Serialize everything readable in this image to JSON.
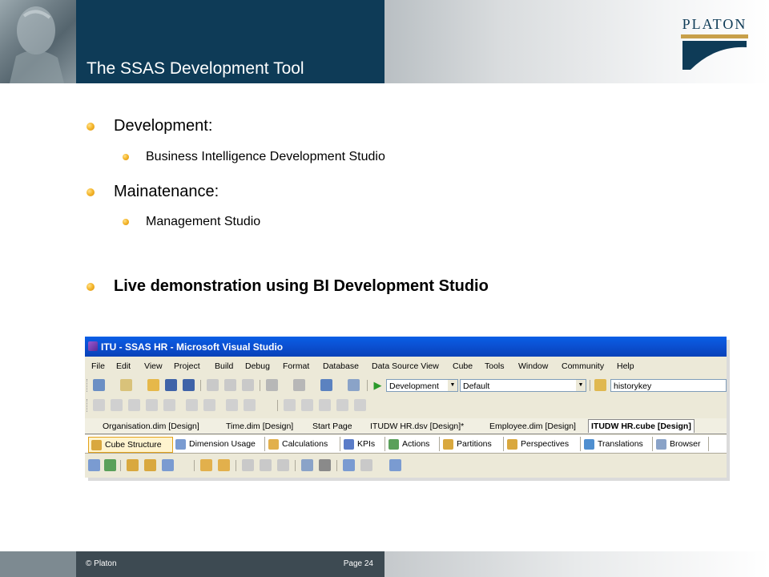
{
  "header": {
    "title": "The SSAS Development Tool",
    "logo_text": "PLATON",
    "colors": {
      "bar": "#0e3b57",
      "accent": "#c8a04a"
    }
  },
  "bullets": [
    {
      "level": 1,
      "text": "Development:"
    },
    {
      "level": 2,
      "text": "Business Intelligence Development Studio"
    },
    {
      "level": 1,
      "text": "Mainatenance:"
    },
    {
      "level": 2,
      "text": "Management Studio"
    },
    {
      "level": 1,
      "text": "Live demonstration using BI Development Studio",
      "bold": true
    }
  ],
  "vs": {
    "window_title": "ITU - SSAS HR - Microsoft Visual Studio",
    "menu": [
      "File",
      "Edit",
      "View",
      "Project",
      "Build",
      "Debug",
      "Format",
      "Database",
      "Data Source View",
      "Cube",
      "Tools",
      "Window",
      "Community",
      "Help"
    ],
    "toolbar": {
      "config_value": "Development",
      "platform_value": "Default",
      "search_value": "historykey"
    },
    "doc_tabs": [
      "Organisation.dim [Design]",
      "Time.dim [Design]",
      "Start Page",
      "ITUDW HR.dsv [Design]*",
      "Employee.dim [Design]",
      "ITUDW HR.cube [Design]"
    ],
    "active_doc_tab": "ITUDW HR.cube [Design]",
    "designer_tabs": [
      "Cube Structure",
      "Dimension Usage",
      "Calculations",
      "KPIs",
      "Actions",
      "Partitions",
      "Perspectives",
      "Translations",
      "Browser"
    ],
    "active_designer_tab": "Cube Structure"
  },
  "footer": {
    "copyright": "© Platon",
    "page": "Page 24"
  }
}
